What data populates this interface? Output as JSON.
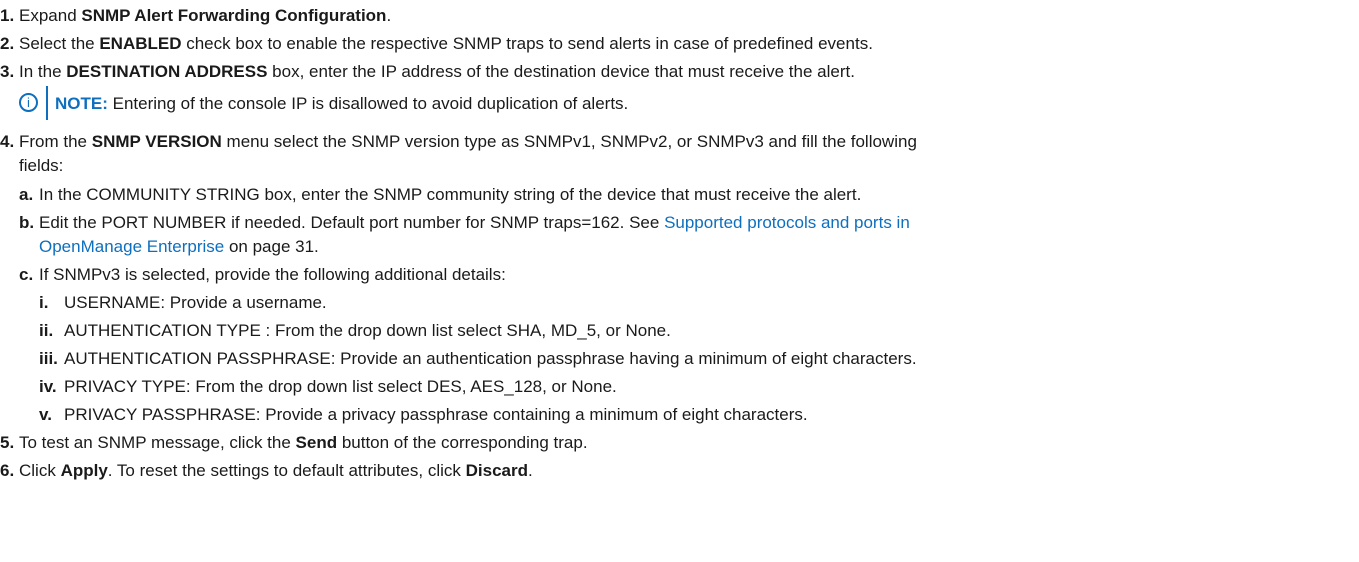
{
  "steps": {
    "s1": {
      "num": "1.",
      "pre": "Expand ",
      "bold": "SNMP Alert Forwarding Configuration",
      "post": "."
    },
    "s2": {
      "num": "2.",
      "pre": "Select the ",
      "bold": "ENABLED",
      "post": " check box to enable the respective SNMP traps to send alerts in case of predefined events."
    },
    "s3": {
      "num": "3.",
      "pre": "In the ",
      "bold": "DESTINATION ADDRESS",
      "post": " box, enter the IP address of the destination device that must receive the alert."
    },
    "note": {
      "icon": "i",
      "label": "NOTE:",
      "text": " Entering of the console IP is disallowed to avoid duplication of alerts."
    },
    "s4": {
      "num": "4.",
      "pre": "From the ",
      "bold": "SNMP VERSION",
      "post": " menu select the SNMP version type as SNMPv1, SNMPv2, or SNMPv3 and fill the following",
      "line2": "fields:"
    },
    "s4a": {
      "num": "a.",
      "text": "In the COMMUNITY STRING box, enter the SNMP community string of the device that must receive the alert."
    },
    "s4b": {
      "num": "b.",
      "pre": "Edit the PORT NUMBER if needed. Default port number for SNMP traps=162. See ",
      "link1": "Supported protocols and ports in",
      "link2": "OpenManage Enterprise",
      "post": " on page 31."
    },
    "s4c": {
      "num": "c.",
      "text": "If SNMPv3 is selected, provide the following additional details:"
    },
    "s4c_i": {
      "num": "i.",
      "text": "USERNAME: Provide a username."
    },
    "s4c_ii": {
      "num": "ii.",
      "text": "AUTHENTICATION TYPE : From the drop down list select SHA, MD_5, or None."
    },
    "s4c_iii": {
      "num": "iii.",
      "text": "AUTHENTICATION PASSPHRASE: Provide an authentication passphrase having a minimum of eight characters."
    },
    "s4c_iv": {
      "num": "iv.",
      "text": "PRIVACY TYPE: From the drop down list select DES, AES_128, or None."
    },
    "s4c_v": {
      "num": "v.",
      "text": "PRIVACY PASSPHRASE: Provide a privacy passphrase containing a minimum of eight characters."
    },
    "s5": {
      "num": "5.",
      "pre": "To test an SNMP message, click the ",
      "bold": "Send",
      "post": " button of the corresponding trap."
    },
    "s6": {
      "num": "6.",
      "pre": "Click ",
      "bold": "Apply",
      "mid": ". To reset the settings to default attributes, click ",
      "bold2": "Discard",
      "post": "."
    }
  },
  "colors": {
    "link": "#0e6fbe",
    "text": "#1a1a1a"
  }
}
